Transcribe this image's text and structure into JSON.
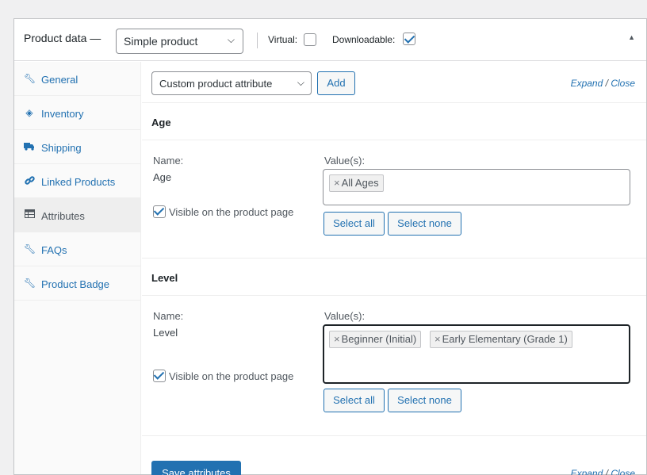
{
  "header": {
    "title": "Product data —",
    "product_type": "Simple product",
    "virtual_label": "Virtual:",
    "virtual_checked": false,
    "downloadable_label": "Downloadable:",
    "downloadable_checked": true,
    "collapse_icon": "triangle-up-icon"
  },
  "sidebar": {
    "items": [
      {
        "label": "General",
        "icon": "wrench-icon"
      },
      {
        "label": "Inventory",
        "icon": "tag-icon"
      },
      {
        "label": "Shipping",
        "icon": "truck-icon"
      },
      {
        "label": "Linked Products",
        "icon": "link-icon"
      },
      {
        "label": "Attributes",
        "icon": "table-icon",
        "active": true
      },
      {
        "label": "FAQs",
        "icon": "wrench-icon"
      },
      {
        "label": "Product Badge",
        "icon": "wrench-icon"
      }
    ]
  },
  "toolbar": {
    "attribute_select": "Custom product attribute",
    "add_label": "Add",
    "expand_label": "Expand",
    "slash": "/",
    "close_label": "Close"
  },
  "attributes": [
    {
      "heading": "Age",
      "name_label": "Name:",
      "name_value": "Age",
      "values_label": "Value(s):",
      "values": [
        "All Ages"
      ],
      "visible_label": "Visible on the product page",
      "visible_checked": true,
      "select_all": "Select all",
      "select_none": "Select none"
    },
    {
      "heading": "Level",
      "name_label": "Name:",
      "name_value": "Level",
      "values_label": "Value(s):",
      "values": [
        "Beginner (Initial)",
        "Early Elementary (Grade 1)"
      ],
      "visible_label": "Visible on the product page",
      "visible_checked": true,
      "select_all": "Select all",
      "select_none": "Select none"
    }
  ],
  "footer": {
    "save_label": "Save attributes",
    "expand_label": "Expand",
    "slash": "/",
    "close_label": "Close"
  },
  "colors": {
    "accent": "#2271b1",
    "background": "#f0f0f1",
    "sidebar_active": "#eeeeee"
  }
}
